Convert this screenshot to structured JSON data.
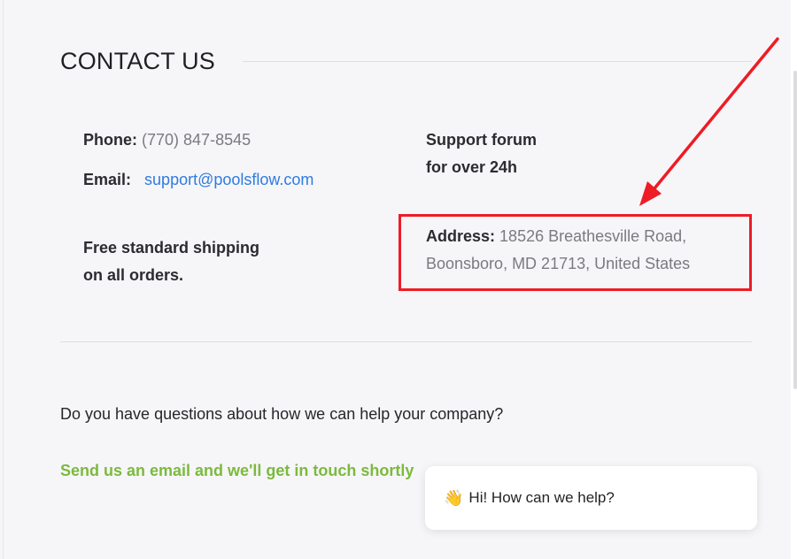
{
  "section": {
    "title": "CONTACT US"
  },
  "contact": {
    "phone_label": "Phone:",
    "phone_value": "(770) 847-8545",
    "email_label": "Email:",
    "email_value": "support@poolsflow.com",
    "shipping_line1": "Free standard shipping",
    "shipping_line2": "on all orders.",
    "support_line1": "Support forum",
    "support_line2": "for over 24h",
    "address_label": "Address:",
    "address_line1": "18526 Breathesville Road,",
    "address_line2": "Boonsboro, MD 21713, United States"
  },
  "cta": {
    "question": "Do you have questions about how we can help your company?",
    "email_link": "Send us an email and we'll get in touch shortly"
  },
  "chat": {
    "icon": "waving-hand-icon",
    "message": "Hi! How can we help?"
  },
  "colors": {
    "accent_green": "#7cba3d",
    "link_blue": "#2f7be0",
    "annotation_red": "#ee1c25"
  }
}
